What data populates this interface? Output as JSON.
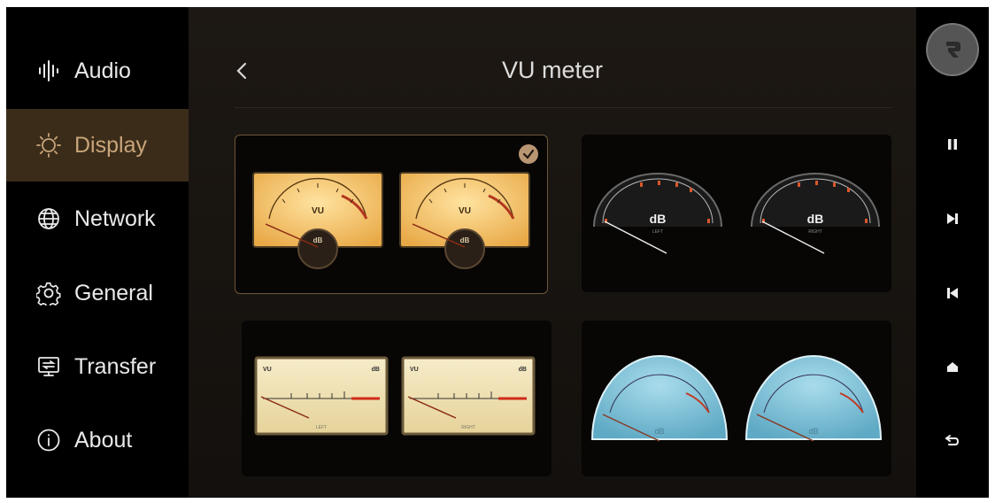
{
  "sidebar": {
    "items": [
      {
        "label": "Audio",
        "icon": "waveform-icon"
      },
      {
        "label": "Display",
        "icon": "brightness-icon",
        "active": true
      },
      {
        "label": "Network",
        "icon": "globe-icon"
      },
      {
        "label": "General",
        "icon": "gear-icon"
      },
      {
        "label": "Transfer",
        "icon": "monitor-transfer-icon"
      },
      {
        "label": "About",
        "icon": "info-icon"
      }
    ]
  },
  "header": {
    "title": "VU meter",
    "back_icon": "chevron-left-icon"
  },
  "meters": {
    "m1": {
      "label": "VU",
      "db": "dB",
      "sel": true
    },
    "m2": {
      "db": "dB",
      "left": "LEFT",
      "right": "RIGHT"
    },
    "m3": {
      "vu": "VU",
      "db": "dB",
      "left": "LEFT",
      "right": "RIGHT"
    },
    "m4": {
      "db": "dB"
    }
  },
  "controls": [
    "pause-icon",
    "next-track-icon",
    "previous-track-icon",
    "home-icon",
    "return-icon"
  ],
  "colors": {
    "accent": "#c9a57a",
    "active_bg": "#3b2c1a",
    "vu_face": "#f3c36b",
    "blue_face": "#7fc0d8"
  }
}
